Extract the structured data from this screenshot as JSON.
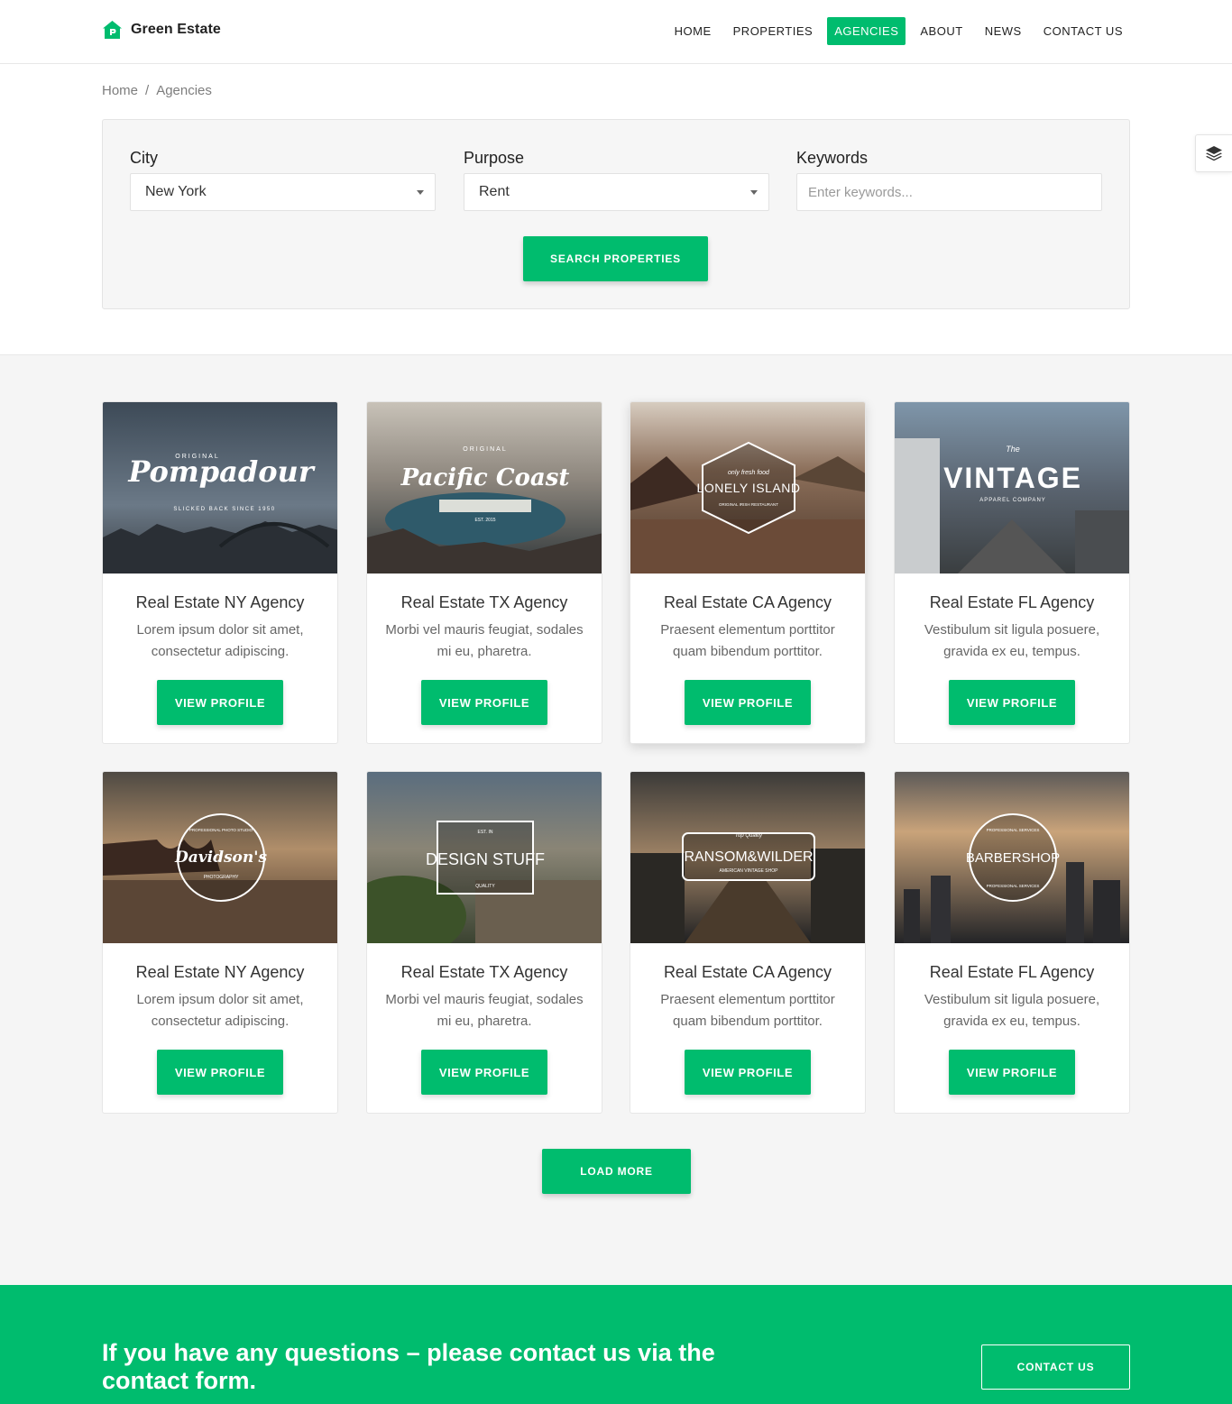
{
  "brand": {
    "name": "Green Estate",
    "accent": "#00bc6e"
  },
  "nav": {
    "items": [
      {
        "label": "HOME",
        "active": false
      },
      {
        "label": "PROPERTIES",
        "active": false
      },
      {
        "label": "AGENCIES",
        "active": true
      },
      {
        "label": "ABOUT",
        "active": false
      },
      {
        "label": "NEWS",
        "active": false
      },
      {
        "label": "CONTACT US",
        "active": false
      }
    ]
  },
  "breadcrumb": {
    "home": "Home",
    "separator": "/",
    "current": "Agencies"
  },
  "search": {
    "city": {
      "label": "City",
      "value": "New York"
    },
    "purpose": {
      "label": "Purpose",
      "value": "Rent"
    },
    "keywords": {
      "label": "Keywords",
      "placeholder": "Enter keywords..."
    },
    "button": "SEARCH PROPERTIES"
  },
  "side_widget": {
    "icon": "layers-icon"
  },
  "agencies": [
    {
      "title": "Real Estate NY Agency",
      "desc": "Lorem ipsum dolor sit amet, consectetur adipiscing.",
      "button": "VIEW PROFILE",
      "badge": "Pompadour",
      "badge_top": "ORIGINAL",
      "badge_bottom": "SLICKED BACK SINCE 1950"
    },
    {
      "title": "Real Estate TX Agency",
      "desc": "Morbi vel mauris feugiat, sodales mi eu, pharetra.",
      "button": "VIEW PROFILE",
      "badge": "Pacific Coast",
      "badge_top": "ORIGINAL",
      "badge_bottom": "EST. 2015"
    },
    {
      "title": "Real Estate CA Agency",
      "desc": "Praesent elementum porttitor quam bibendum porttitor.",
      "button": "VIEW PROFILE",
      "badge": "LONELY ISLAND",
      "badge_top": "only fresh food",
      "badge_bottom": "ORIGINAL IRISH RESTAURANT"
    },
    {
      "title": "Real Estate FL Agency",
      "desc": "Vestibulum sit ligula posuere, gravida ex eu, tempus.",
      "button": "VIEW PROFILE",
      "badge": "VINTAGE",
      "badge_top": "The",
      "badge_bottom": "APPAREL COMPANY"
    },
    {
      "title": "Real Estate NY Agency",
      "desc": "Lorem ipsum dolor sit amet, consectetur adipiscing.",
      "button": "VIEW PROFILE",
      "badge": "Davidson's",
      "badge_top": "PROFESSIONAL PHOTO STUDIO",
      "badge_bottom": "PHOTOGRAPHY"
    },
    {
      "title": "Real Estate TX Agency",
      "desc": "Morbi vel mauris feugiat, sodales mi eu, pharetra.",
      "button": "VIEW PROFILE",
      "badge": "DESIGN STUFF",
      "badge_top": "EST. IN",
      "badge_bottom": "QUALITY"
    },
    {
      "title": "Real Estate CA Agency",
      "desc": "Praesent elementum porttitor quam bibendum porttitor.",
      "button": "VIEW PROFILE",
      "badge": "RANSOM&WILDER",
      "badge_top": "Top Quality",
      "badge_bottom": "AMERICAN VINTAGE SHOP"
    },
    {
      "title": "Real Estate FL Agency",
      "desc": "Vestibulum sit ligula posuere, gravida ex eu, tempus.",
      "button": "VIEW PROFILE",
      "badge": "BARBERSHOP",
      "badge_top": "PROFESSIONAL SERVICES",
      "badge_bottom": "PROFESSIONAL SERVICES"
    }
  ],
  "load_more": "LOAD MORE",
  "cta": {
    "text": "If you have any questions – please contact us via the contact form.",
    "button": "CONTACT US"
  }
}
